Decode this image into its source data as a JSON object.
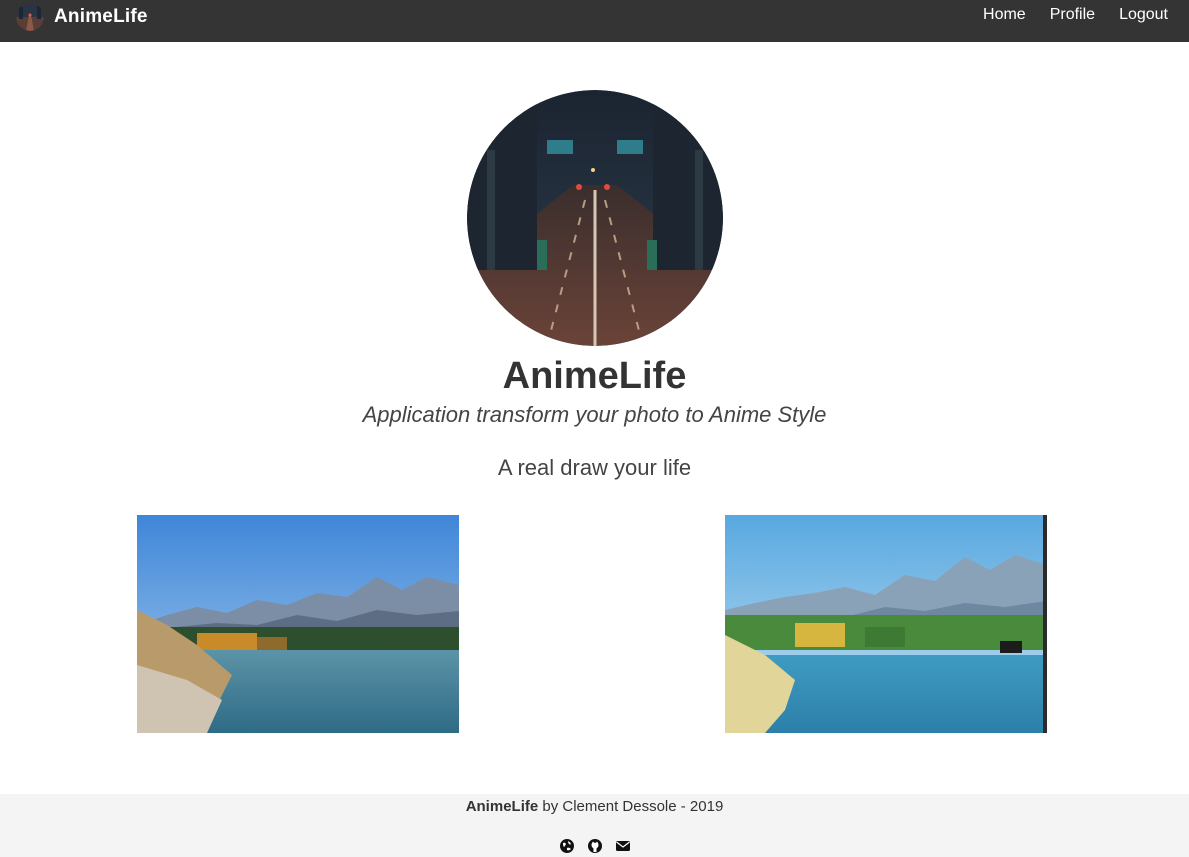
{
  "navbar": {
    "brand": "AnimeLife",
    "links": [
      {
        "label": "Home"
      },
      {
        "label": "Profile"
      },
      {
        "label": "Logout"
      }
    ]
  },
  "hero": {
    "title": "AnimeLife",
    "subtitle": "Application transform your photo to Anime Style",
    "tagline": "A real draw your life"
  },
  "images": {
    "original": "landscape-photo",
    "converted": "anime-style-photo"
  },
  "footer": {
    "brand": "AnimeLife",
    "text": " by Clement Dessole - 2019",
    "icons": [
      "globe-icon",
      "github-icon",
      "envelope-icon"
    ]
  }
}
